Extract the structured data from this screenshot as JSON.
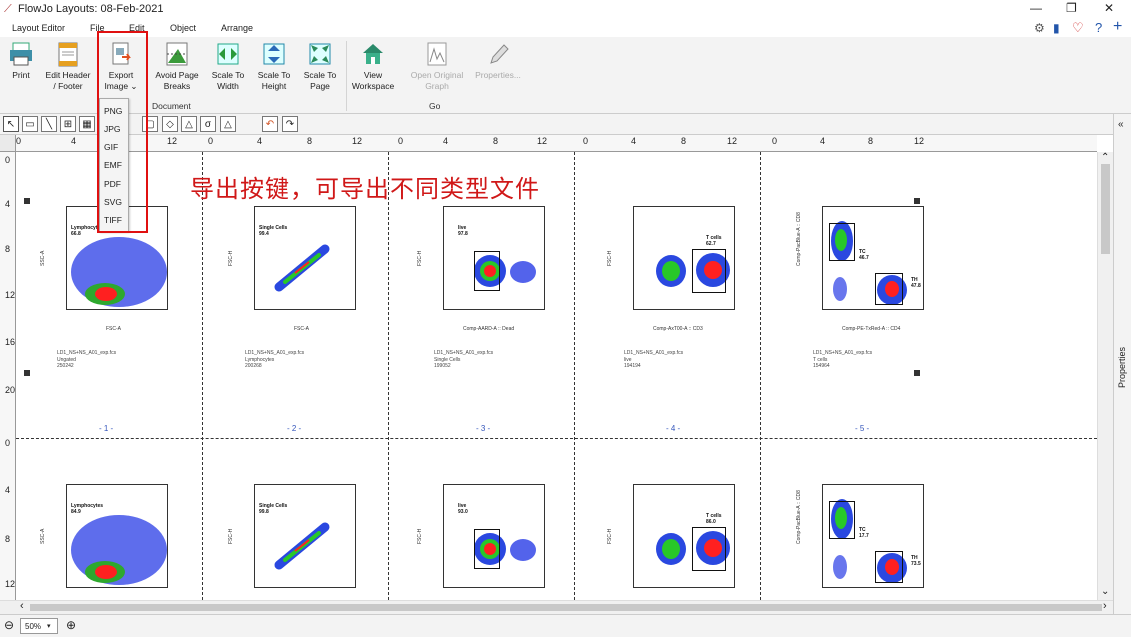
{
  "window": {
    "title": "FlowJo Layouts: 08-Feb-2021",
    "controls": [
      "—",
      "❐",
      "✕"
    ],
    "right_icons": [
      "⚙",
      "▮",
      "♡",
      "?",
      "+"
    ]
  },
  "menu": [
    "Layout Editor",
    "File",
    "Edit",
    "Object",
    "Arrange"
  ],
  "ribbon": {
    "buttons": [
      {
        "l1": "Print",
        "l2": ""
      },
      {
        "l1": "Edit Header",
        "l2": "/ Footer"
      },
      {
        "l1": "Export",
        "l2": "Image ⌄"
      },
      {
        "l1": "Avoid Page",
        "l2": "Breaks"
      },
      {
        "l1": "Scale To",
        "l2": "Width"
      },
      {
        "l1": "Scale To",
        "l2": "Height"
      },
      {
        "l1": "Scale To",
        "l2": "Page"
      },
      {
        "l1": "View",
        "l2": "Workspace"
      },
      {
        "l1": "Open Original",
        "l2": "Graph"
      },
      {
        "l1": "Properties...",
        "l2": ""
      }
    ],
    "groups": [
      "Document",
      "Go"
    ]
  },
  "export_menu": [
    "PNG",
    "JPG",
    "GIF",
    "EMF",
    "PDF",
    "SVG",
    "TIFF"
  ],
  "annotation": "导出按键，可导出不同类型文件",
  "ruler": {
    "h": [
      "0",
      "4",
      "8",
      "12",
      "0",
      "4",
      "8",
      "12",
      "0",
      "4",
      "8",
      "12",
      "0",
      "4",
      "8",
      "12",
      "0",
      "4",
      "8",
      "12"
    ],
    "v": [
      "0",
      "4",
      "8",
      "12",
      "16",
      "20",
      "0",
      "4",
      "8",
      "12"
    ]
  },
  "pages": [
    "- 1 -",
    "- 2 -",
    "- 3 -",
    "- 4 -",
    "- 5 -"
  ],
  "plots": [
    {
      "y": "SSC-A",
      "x": "FSC-A",
      "gate": "Lymphocytes",
      "val": "66.8",
      "file": "LD1_NS+NS_A01_exp.fcs",
      "pop": "Ungated",
      "count": "250242"
    },
    {
      "y": "FSC-H",
      "x": "FSC-A",
      "gate": "Single Cells",
      "val": "99.4",
      "file": "LD1_NS+NS_A01_exp.fcs",
      "pop": "Lymphocytes",
      "count": "200268"
    },
    {
      "y": "FSC-H",
      "x": "Comp-AARD-A :: Dead",
      "gate": "live",
      "val": "97.8",
      "file": "LD1_NS+NS_A01_exp.fcs",
      "pop": "Single Cells",
      "count": "199052"
    },
    {
      "y": "FSC-H",
      "x": "Comp-AxT00-A :: CD3",
      "gate": "T cells",
      "val": "62.7",
      "file": "LD1_NS+NS_A01_exp.fcs",
      "pop": "live",
      "count": "194194"
    },
    {
      "y": "Comp-PacBlue-A :: CD8",
      "x": "Comp-PE-TxRed-A :: CD4",
      "gate": "TC",
      "val": "46.7",
      "gate2": "TH",
      "val2": "47.8",
      "file": "LD1_NS+NS_A01_exp.fcs",
      "pop": "T cells",
      "count": "154964"
    }
  ],
  "plots_row2": [
    {
      "y": "SSC-A",
      "gate": "Lymphocytes",
      "val": "84.9"
    },
    {
      "y": "FSC-H",
      "gate": "Single Cells",
      "val": "99.8"
    },
    {
      "y": "FSC-H",
      "gate": "live",
      "val": "93.0"
    },
    {
      "y": "FSC-H",
      "gate": "T cells",
      "val": "86.0"
    },
    {
      "y": "Comp-PacBlue-A :: CD8",
      "gate": "TC",
      "val": "17.7",
      "gate2": "TH",
      "val2": "73.5"
    }
  ],
  "status": {
    "zoom": "50%",
    "zoom_arrow": "▾"
  },
  "side_panel": "Properties",
  "scroll": {
    "up": "⌃",
    "down": "⌄",
    "left": "‹",
    "right": "›"
  },
  "colors": {
    "highlight": "#e01010",
    "annotation": "#d01818",
    "page_numbers": "#3355bb"
  }
}
